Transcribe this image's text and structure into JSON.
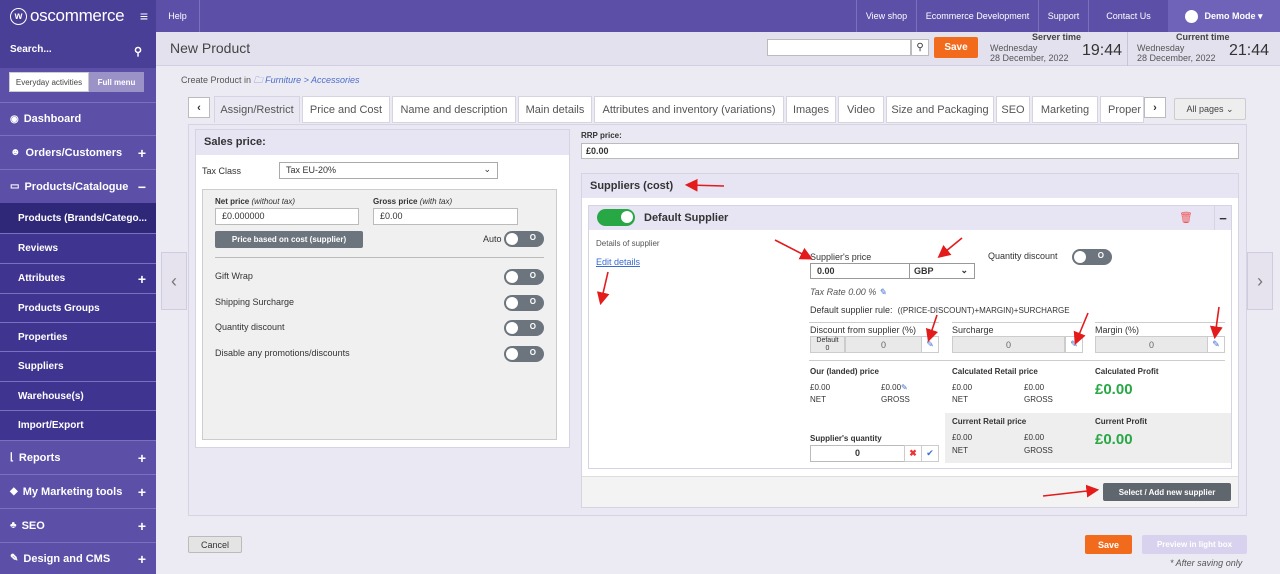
{
  "app": {
    "logo": "oscommerce",
    "title": "New Product"
  },
  "sidebar": {
    "search_label": "Search...",
    "toggle_left": "Everyday activities",
    "toggle_right": "Full menu",
    "items": [
      {
        "label": "Dashboard",
        "icon": "dashboard-icon"
      },
      {
        "label": "Orders/Customers",
        "icon": "users-icon"
      },
      {
        "label": "Products/Catalogue",
        "icon": "folder-icon"
      },
      {
        "label": "Products (Brands/Catego..."
      },
      {
        "label": "Reviews"
      },
      {
        "label": "Attributes"
      },
      {
        "label": "Products Groups"
      },
      {
        "label": "Properties"
      },
      {
        "label": "Suppliers"
      },
      {
        "label": "Warehouse(s)"
      },
      {
        "label": "Import/Export"
      },
      {
        "label": "Reports",
        "icon": "chart-icon"
      },
      {
        "label": "My Marketing tools",
        "icon": "tag-icon"
      },
      {
        "label": "SEO",
        "icon": "sitemap-icon"
      },
      {
        "label": "Design and CMS",
        "icon": "brush-icon"
      }
    ]
  },
  "topbar": {
    "help": "Help",
    "links": [
      "View shop",
      "Ecommerce Development",
      "Support",
      "Contact Us"
    ],
    "user": "Demo Mode"
  },
  "header": {
    "save": "Save",
    "server_time_label": "Server time",
    "server_day": "Wednesday",
    "server_date": "28 December, 2022",
    "server_time": "19:44",
    "current_time_label": "Current time",
    "current_day": "Wednesday",
    "current_date": "28 December, 2022",
    "current_time": "21:44"
  },
  "breadcrumb": {
    "prefix": "Create Product in",
    "path": "Furniture > Accessories"
  },
  "tabs": [
    "Assign/Restrict",
    "Price and Cost",
    "Name and description",
    "Main details",
    "Attributes and inventory (variations)",
    "Images",
    "Video",
    "Size and Packaging",
    "SEO",
    "Marketing",
    "Proper"
  ],
  "all_pages": "All pages",
  "sales": {
    "title": "Sales price:",
    "tax_class_label": "Tax Class",
    "tax_class_value": "Tax EU-20%",
    "net_label": "Net price",
    "net_hint": "(without tax)",
    "net_value": "£0.000000",
    "gross_label": "Gross price",
    "gross_hint": "(with tax)",
    "gross_value": "£0.00",
    "price_based_btn": "Price based on cost (supplier)",
    "auto_label": "Auto",
    "options": [
      "Gift Wrap",
      "Shipping Surcharge",
      "Quantity discount",
      "Disable any promotions/discounts"
    ],
    "toggle_off": "O"
  },
  "rrp": {
    "label": "RRP price:",
    "value": "£0.00"
  },
  "suppliers": {
    "title": "Suppliers (cost)",
    "default_title": "Default Supplier",
    "details_label": "Details of supplier",
    "edit_details": "Edit details",
    "supplier_price_label": "Supplier's price",
    "supplier_price_value": "0.00",
    "currency": "GBP",
    "quantity_discount_label": "Quantity discount",
    "tax_rate": "Tax Rate 0.00 %",
    "rule_label": "Default supplier rule:",
    "rule_value": "((PRICE-DISCOUNT)+MARGIN)+SURCHARGE",
    "discount_label": "Discount from supplier (%)",
    "discount_default_label": "Default",
    "discount_default_value": "0",
    "discount_value": "0",
    "surcharge_label": "Surcharge",
    "surcharge_value": "0",
    "margin_label": "Margin (%)",
    "margin_value": "0",
    "landed_label": "Our (landed) price",
    "landed_net": "£0.00",
    "landed_gross": "£0.00",
    "calc_retail_label": "Calculated Retail price",
    "calc_retail_net": "£0.00",
    "calc_retail_gross": "£0.00",
    "calc_profit_label": "Calculated Profit",
    "calc_profit": "£0.00",
    "net": "NET",
    "gross": "GROSS",
    "current_retail_label": "Current Retail price",
    "current_retail_net": "£0.00",
    "current_retail_gross": "£0.00",
    "current_profit_label": "Current Profit",
    "current_profit": "£0.00",
    "quantity_label": "Supplier's quantity",
    "quantity_value": "0",
    "select_btn": "Select / Add new supplier"
  },
  "bottom": {
    "cancel": "Cancel",
    "save": "Save",
    "preview": "Preview in light box",
    "after_saving": "* After saving only"
  }
}
